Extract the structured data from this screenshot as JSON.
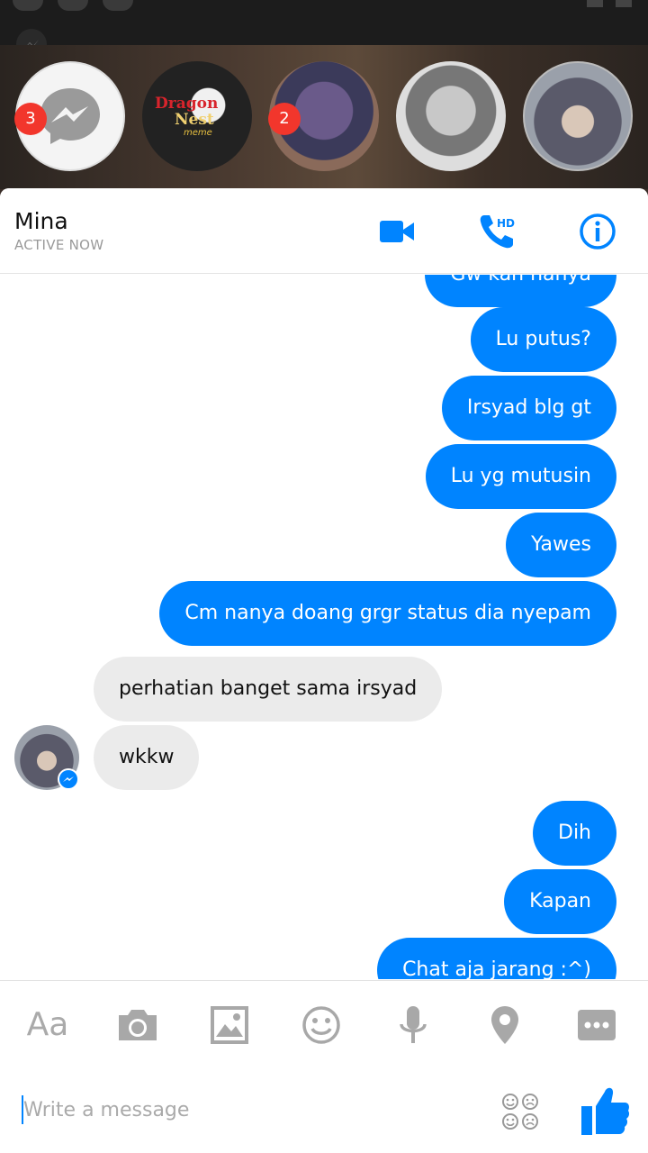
{
  "chat_heads": [
    {
      "name": "messenger-home",
      "badge": "3"
    },
    {
      "name": "dragon-nest",
      "title_line1": "Dragon",
      "title_line2": "Nest",
      "subtitle": "meme"
    },
    {
      "name": "contact-2",
      "badge": "2"
    },
    {
      "name": "contact-3"
    },
    {
      "name": "contact-mina"
    }
  ],
  "header": {
    "contact_name": "Mina",
    "status": "ACTIVE NOW",
    "hd_label": "HD"
  },
  "messages": [
    {
      "dir": "out",
      "text": "Gw kan nanya"
    },
    {
      "dir": "out",
      "text": "Lu putus?"
    },
    {
      "dir": "out",
      "text": "Irsyad blg gt"
    },
    {
      "dir": "out",
      "text": "Lu yg mutusin"
    },
    {
      "dir": "out",
      "text": "Yawes"
    },
    {
      "dir": "out",
      "text": "Cm nanya doang grgr status dia nyepam"
    },
    {
      "dir": "in",
      "text": "perhatian banget sama irsyad"
    },
    {
      "dir": "in",
      "text": "wkkw"
    },
    {
      "dir": "out",
      "text": "Dih"
    },
    {
      "dir": "out",
      "text": "Kapan"
    },
    {
      "dir": "out",
      "text": "Chat aja jarang  :^)"
    }
  ],
  "composer": {
    "text_tool_label": "Aa",
    "placeholder": "Write a message"
  },
  "colors": {
    "accent": "#0084ff",
    "incoming_bubble": "#ebebeb",
    "badge": "#f2362c"
  },
  "icons": [
    "messenger-icon",
    "video-call-icon",
    "hd-phone-icon",
    "info-icon",
    "camera-icon",
    "image-icon",
    "emoji-icon",
    "microphone-icon",
    "location-icon",
    "more-icon",
    "stickers-icon",
    "thumbs-up-icon"
  ]
}
